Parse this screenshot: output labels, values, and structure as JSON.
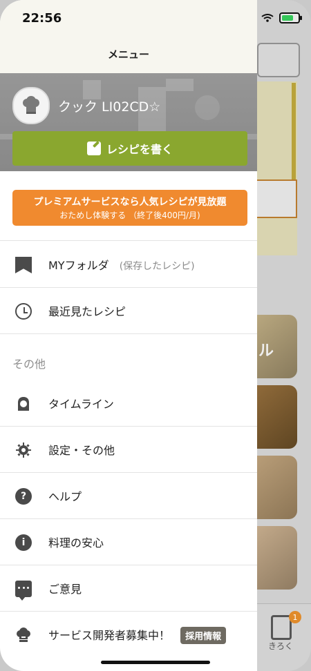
{
  "status": {
    "time": "22:56"
  },
  "drawer": {
    "title": "メニュー",
    "profile": {
      "username": "クック LI02CD☆"
    },
    "write_recipe": "レシピを書く",
    "premium": {
      "line1": "プレミアムサービスなら人気レシピが見放題",
      "line2": "おためし体験する （終了後400円/月)"
    },
    "menu": {
      "my_folder": {
        "label": "MYフォルダ",
        "sub": "(保存したレシピ)"
      },
      "recent": {
        "label": "最近見たレシピ"
      }
    },
    "section_other": "その他",
    "other_items": [
      {
        "label": "タイムライン"
      },
      {
        "label": "設定・その他"
      },
      {
        "label": "ヘルプ"
      },
      {
        "label": "料理の安心"
      },
      {
        "label": "ご意見"
      },
      {
        "label": "サービス開発者募集中！",
        "tag": "採用情報"
      }
    ]
  },
  "background": {
    "tabbar": {
      "kiroku_label": "きろく",
      "kiroku_badge": "1"
    },
    "food_card_text": "ル"
  },
  "colors": {
    "accent_green": "#8aa72f",
    "premium_orange": "#f08a2f",
    "badge_orange": "#e08a2a"
  }
}
